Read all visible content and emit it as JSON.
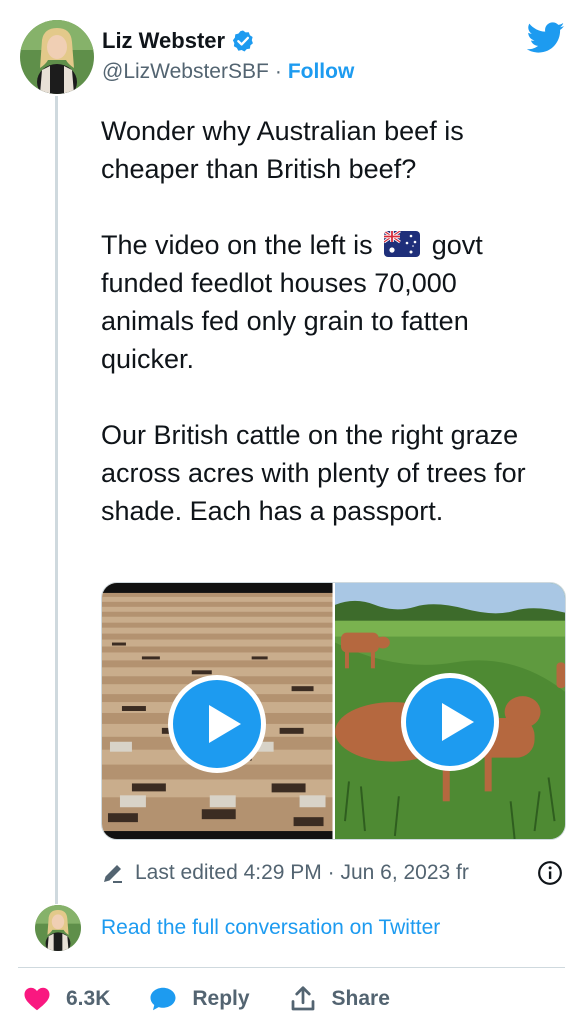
{
  "author": {
    "display_name": "Liz Webster",
    "handle": "@LizWebsterSBF",
    "separator": "·",
    "follow_label": "Follow",
    "verified": true,
    "avatar_icon": "user-avatar"
  },
  "tweet": {
    "paragraphs": [
      "Wonder why Australian beef is cheaper than British beef?",
      {
        "before": "The video on the left is",
        "flag_icon": "australia-flag",
        "after": "govt funded feedlot houses 70,000 animals fed only grain to fatten quicker."
      },
      "Our British cattle  on the right graze across acres with plenty of trees for shade. Each has a passport."
    ]
  },
  "media": {
    "videos": [
      {
        "icon": "play-icon",
        "scene": "feedlot-aerial"
      },
      {
        "icon": "play-icon",
        "scene": "cattle-in-field"
      }
    ]
  },
  "meta": {
    "edited_text": "Last edited 4:29 PM · Jun 6, 2023 fr",
    "pencil_icon": "pencil-icon",
    "info_icon": "info-icon"
  },
  "footer": {
    "read_link": "Read the full conversation on Twitter",
    "likes": "6.3K",
    "reply_label": "Reply",
    "share_label": "Share"
  },
  "colors": {
    "accent": "#1d9bf0",
    "like": "#f91880",
    "secondary_text": "#536471",
    "text": "#0f1419"
  }
}
